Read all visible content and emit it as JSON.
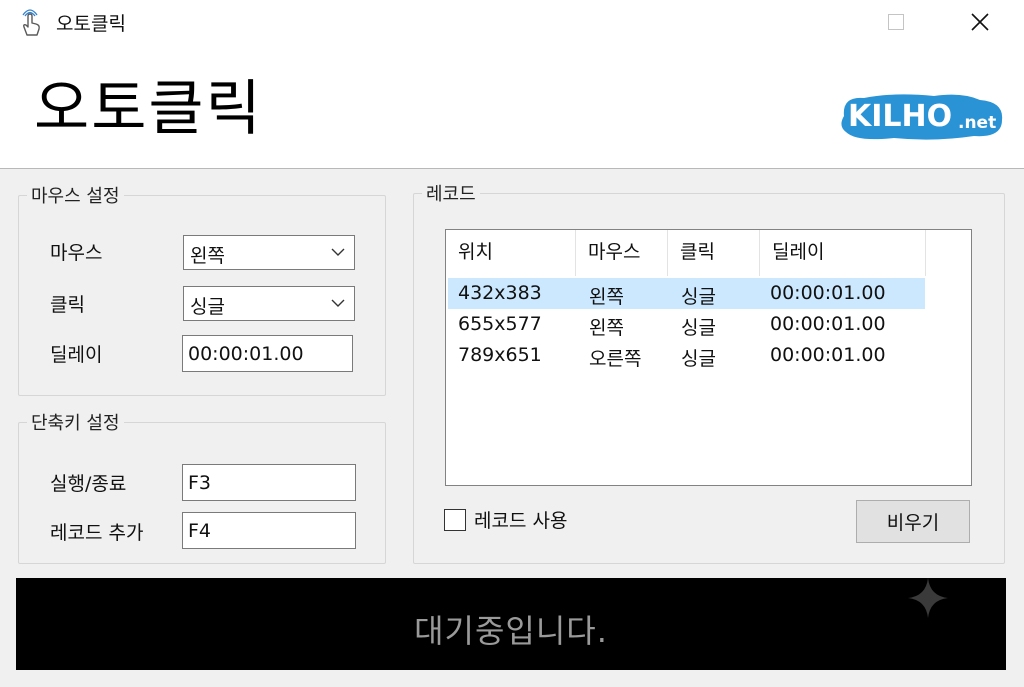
{
  "window": {
    "title": "오토클릭"
  },
  "header": {
    "title": "오토클릭",
    "logo_text": "KILHO",
    "logo_suffix": ".net"
  },
  "mouse_settings": {
    "legend": "마우스 설정",
    "mouse_label": "마우스",
    "mouse_value": "왼쪽",
    "click_label": "클릭",
    "click_value": "싱글",
    "delay_label": "딜레이",
    "delay_value": "00:00:01.00"
  },
  "hotkey_settings": {
    "legend": "단축키 설정",
    "run_label": "실행/종료",
    "run_value": "F3",
    "add_label": "레코드 추가",
    "add_value": "F4"
  },
  "record": {
    "legend": "레코드",
    "columns": [
      "위치",
      "마우스",
      "클릭",
      "딜레이"
    ],
    "rows": [
      {
        "pos": "432x383",
        "mouse": "왼쪽",
        "click": "싱글",
        "delay": "00:00:01.00",
        "selected": true
      },
      {
        "pos": "655x577",
        "mouse": "왼쪽",
        "click": "싱글",
        "delay": "00:00:01.00",
        "selected": false
      },
      {
        "pos": "789x651",
        "mouse": "오른쪽",
        "click": "싱글",
        "delay": "00:00:01.00",
        "selected": false
      }
    ],
    "use_record_label": "레코드 사용",
    "use_record_checked": false,
    "clear_button": "비우기"
  },
  "status": {
    "text": "대기중입니다."
  },
  "colors": {
    "selection": "#cce8ff",
    "logo_blue": "#2a93d5",
    "status_bg": "#000000",
    "status_text": "#9a9a9a"
  }
}
